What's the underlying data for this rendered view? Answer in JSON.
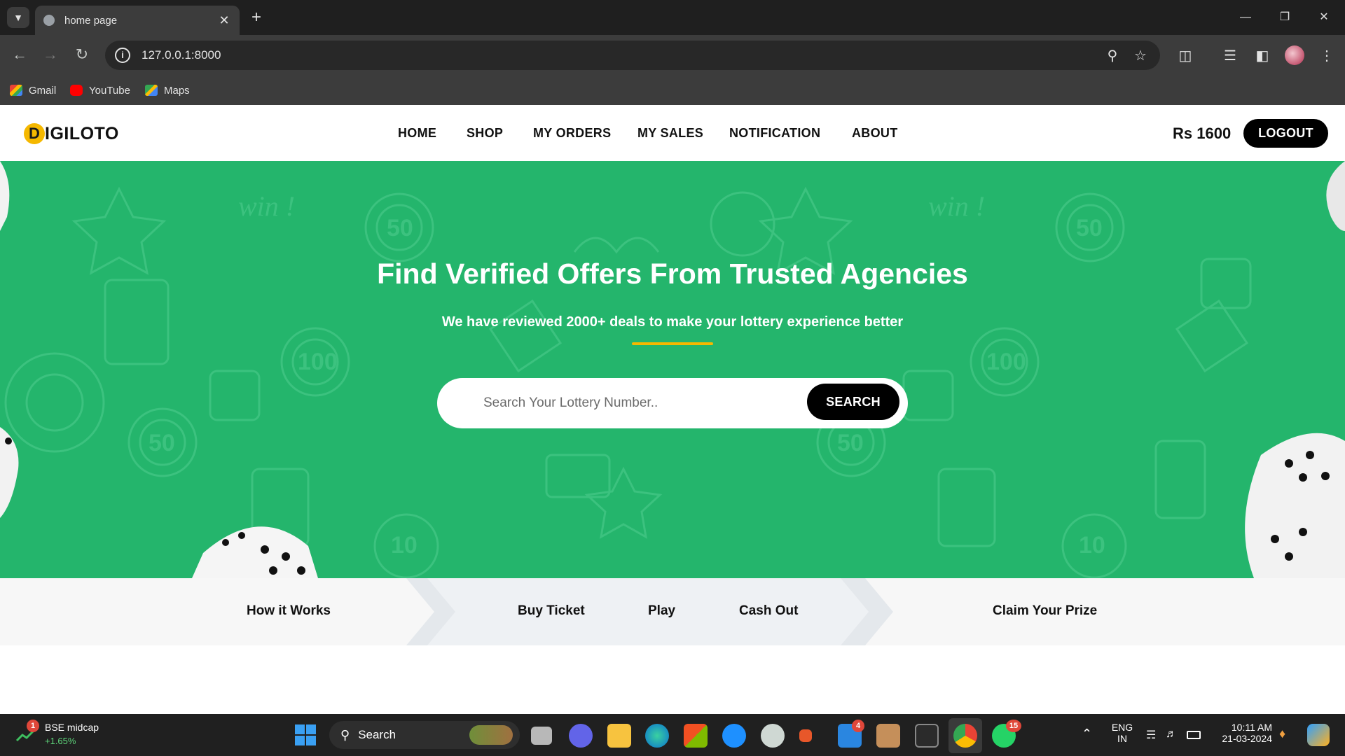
{
  "browser": {
    "tab_title": "home page",
    "url": "127.0.0.1:8000",
    "bookmarks": [
      {
        "label": "Gmail"
      },
      {
        "label": "YouTube"
      },
      {
        "label": "Maps"
      }
    ]
  },
  "site": {
    "logo_letter": "D",
    "logo_text": "IGILOTO",
    "nav": [
      "HOME",
      "SHOP",
      "MY ORDERS",
      "MY SALES",
      "NOTIFICATION",
      "ABOUT"
    ],
    "balance": "Rs 1600",
    "logout_label": "LOGOUT"
  },
  "hero": {
    "title": "Find Verified Offers From Trusted Agencies",
    "subtitle": "We have reviewed 2000+ deals to make your lottery experience better",
    "search_placeholder": "Search Your Lottery Number..",
    "search_button": "SEARCH",
    "background_color": "#24b56c",
    "accent_color": "#f5b800"
  },
  "steps": [
    "How it Works",
    "Buy Ticket",
    "Play",
    "Cash Out",
    "Claim Your Prize"
  ],
  "taskbar": {
    "widget_badge": "1",
    "widget_title": "BSE midcap",
    "widget_value": "+1.65%",
    "search_label": "Search",
    "mail_badge": "4",
    "whatsapp_badge": "15",
    "lang_line1": "ENG",
    "lang_line2": "IN",
    "time": "10:11 AM",
    "date": "21-03-2024"
  }
}
